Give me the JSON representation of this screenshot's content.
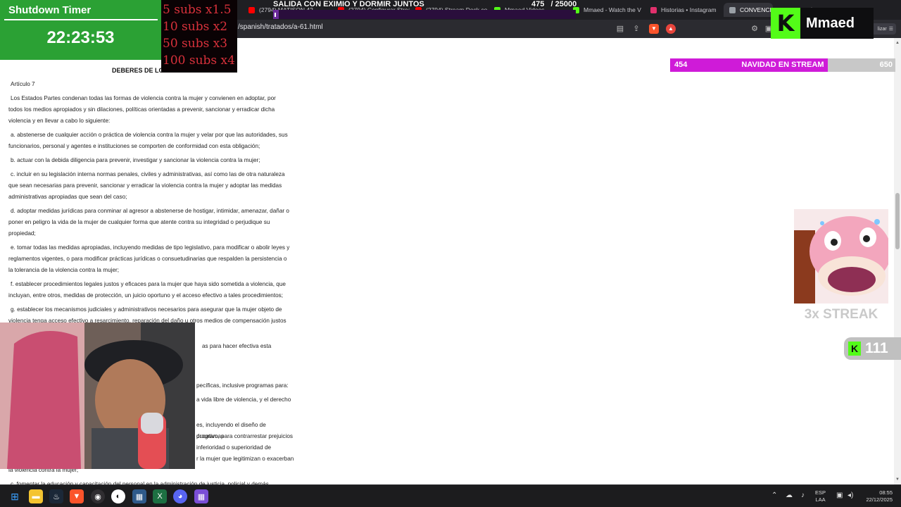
{
  "browser": {
    "tabs": [
      {
        "label": "(2794) MATISON 42",
        "icon": "youtube-icon",
        "color": "#ff0000"
      },
      {
        "label": "(2794) Configurar Streamlabs",
        "icon": "youtube-icon",
        "color": "#ff0000"
      },
      {
        "label": "(2794) Stream Deck co...",
        "icon": "youtube-icon",
        "color": "#ff0000"
      },
      {
        "label": "Mmaed Videos",
        "icon": "kick-icon",
        "color": "#53fc18"
      },
      {
        "label": "Mmaed - Watch the V",
        "icon": "kick-icon",
        "color": "#53fc18"
      },
      {
        "label": "Historias • Instagram",
        "icon": "instagram-icon",
        "color": "#e1306c"
      },
      {
        "label": "CONVENCIO",
        "icon": "page-icon",
        "color": "#9aa0a6"
      }
    ],
    "url": "/spanish/tratados/a-61.html",
    "kick_button_label": "lizar"
  },
  "overlays": {
    "timer": {
      "title": "Shutdown Timer",
      "time": "22:23:53"
    },
    "multipliers": [
      "5 subs x1.5",
      "10 subs x2",
      "50 subs x3",
      "100 subs x4"
    ],
    "goal": {
      "title": "SALIDA CON EXIMIO Y DORMIR JUNTOS",
      "current": "475",
      "target": "/ 25000",
      "fraction": 0.019
    },
    "kick_logo": {
      "k": "K",
      "name": "Mmaed"
    },
    "navidad": {
      "current": "454",
      "label": "NAVIDAD EN STREAM",
      "target": "650",
      "fraction": 0.6985
    },
    "streak": {
      "text": "3x STREAK"
    },
    "kick_count": {
      "k": "K",
      "value": "111"
    }
  },
  "document": {
    "heading": "DEBERES DE LOS",
    "article": "Artículo 7",
    "paragraphs": [
      "Los Estados Partes condenan todas las formas de violencia contra la mujer y convienen en adoptar, por todos los medios apropiados y sin dilaciones, políticas orientadas a prevenir, sancionar y erradicar dicha violencia y en llevar a cabo lo siguiente:",
      "a. abstenerse de cualquier acción o práctica de violencia contra la mujer y velar por que las autoridades, sus funcionarios, personal y agentes e instituciones se comporten de conformidad con esta obligación;",
      "b. actuar con la debida diligencia para prevenir, investigar y sancionar la violencia contra la mujer;",
      "c. incluir en su legislación interna normas penales, civiles y administrativas, así como las de otra naturaleza que sean necesarias para prevenir, sancionar y erradicar la violencia contra la mujer y adoptar las medidas administrativas apropiadas que sean del caso;",
      "d. adoptar medidas jurídicas para conminar al agresor a abstenerse de hostigar, intimidar, amenazar, dañar o poner en peligro la vida de la mujer de cualquier forma que atente contra su integridad o perjudique su propiedad;",
      "e. tomar todas las medidas apropiadas, incluyendo medidas de tipo legislativo, para modificar o abolir leyes y reglamentos vigentes, o para modificar prácticas jurídicas o consuetudinarias que respalden la persistencia o la tolerancia de la violencia contra la mujer;",
      "f. establecer procedimientos legales justos y eficaces para la mujer que haya sido sometida a violencia, que incluyan, entre otros, medidas de protección, un juicio oportuno y el acceso efectivo a tales procedimientos;",
      "g. establecer los mecanismos judiciales y administrativos necesarios para asegurar que la mujer objeto de violencia tenga acceso efectivo a resarcimiento, reparación del daño u otros medios de compensación justos y"
    ],
    "fragments": [
      "as para hacer efectiva esta",
      "pecíficas, inclusive programas para:",
      "a vida libre de violencia, y el derecho",
      "es, incluyendo el diseño de programas",
      "ducativo, para contrarrestar prejuicios",
      "inferioridad o superioridad de",
      "r la mujer que legitimizan o exacerban",
      "la violencia contra la mujer;",
      "c. fomentar la educación y capacitación del personal en la administración de justicia, policial y demás"
    ]
  },
  "taskbar": {
    "apps": [
      "windows-start",
      "file-explorer",
      "steam",
      "brave",
      "obs",
      "kick",
      "calculator",
      "excel",
      "discord",
      "app-grid"
    ],
    "language": [
      "ESP",
      "LAA"
    ],
    "time": "08:55",
    "date": "22/12/2025"
  }
}
